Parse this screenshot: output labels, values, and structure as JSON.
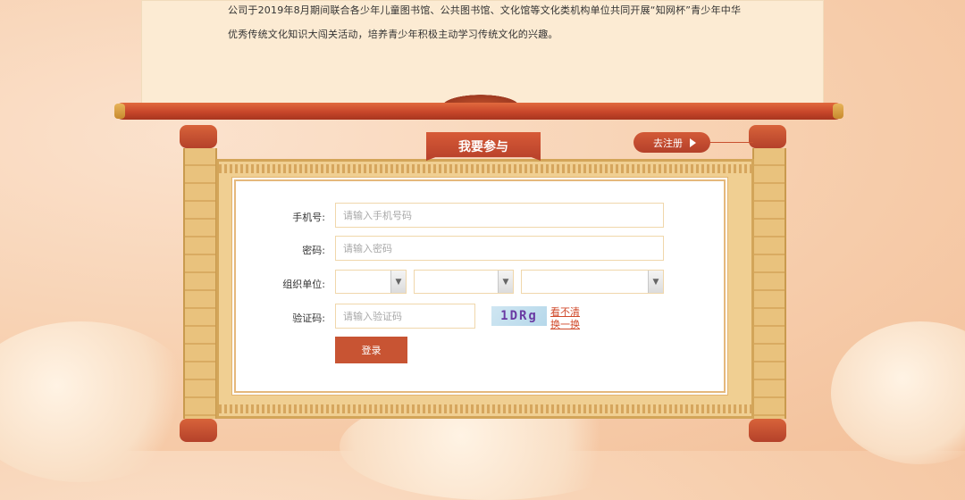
{
  "intro": {
    "line1": "公司于2019年8月期间联合各少年儿童图书馆、公共图书馆、文化馆等文化类机构单位共同开展“知网杯”青少年中华",
    "line2": "优秀传统文化知识大闯关活动，培养青少年积极主动学习传统文化的兴趣。"
  },
  "tab_title": "我要参与",
  "register_link": "去注册",
  "form": {
    "phone_label": "手机号:",
    "phone_placeholder": "请输入手机号码",
    "password_label": "密码:",
    "password_placeholder": "请输入密码",
    "org_label": "组织单位:",
    "captcha_label": "验证码:",
    "captcha_placeholder": "请输入验证码",
    "captcha_text": "1DRg",
    "captcha_refresh_line1": "看不清",
    "captcha_refresh_line2": "换一换",
    "submit_label": "登录"
  },
  "colors": {
    "accent": "#c85433",
    "background": "#f7cfae",
    "scroll_paper": "#f0cf92"
  }
}
